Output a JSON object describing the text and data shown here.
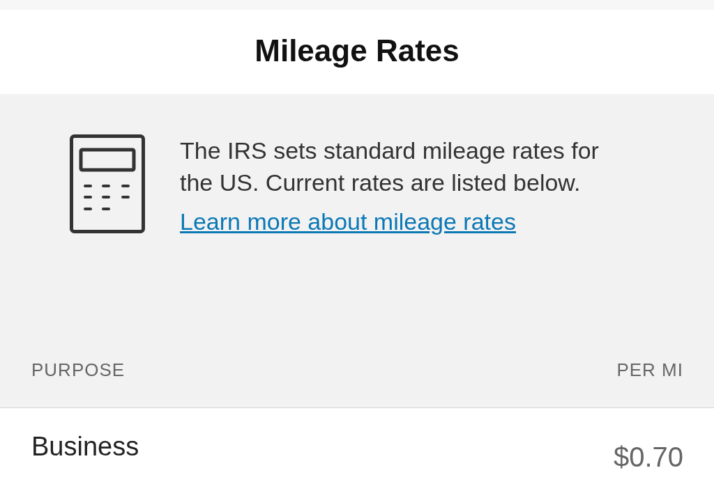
{
  "header": {
    "title": "Mileage Rates"
  },
  "info": {
    "text": "The IRS sets standard mileage rates for the US. Current rates are listed below.",
    "link": "Learn more about mileage rates"
  },
  "table": {
    "columns": [
      "PURPOSE",
      "PER MI"
    ],
    "rows": [
      {
        "purpose": "Business",
        "rate": "$0.70"
      }
    ]
  }
}
